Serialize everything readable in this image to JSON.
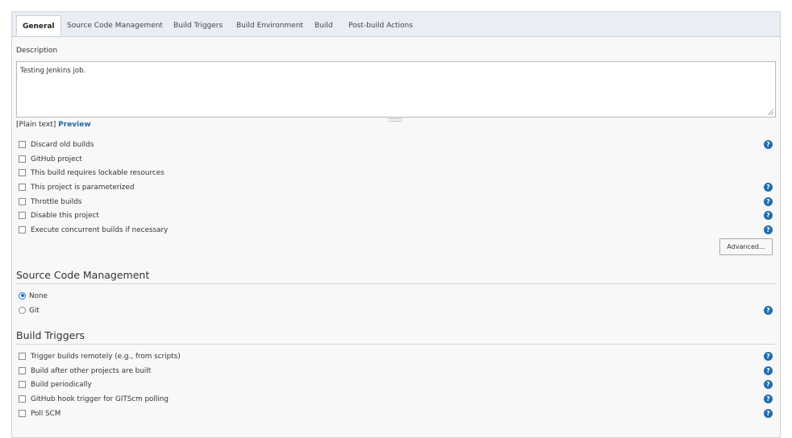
{
  "tabs": [
    {
      "label": "General",
      "active": true
    },
    {
      "label": "Source Code Management",
      "active": false
    },
    {
      "label": "Build Triggers",
      "active": false
    },
    {
      "label": "Build Environment",
      "active": false
    },
    {
      "label": "Build",
      "active": false
    },
    {
      "label": "Post-build Actions",
      "active": false
    }
  ],
  "general": {
    "description_label": "Description",
    "description_value": "Testing Jenkins job.",
    "plain_text_label": "[Plain text]",
    "preview_link": "Preview",
    "options": [
      {
        "label": "Discard old builds",
        "checked": false,
        "help": true
      },
      {
        "label": "GitHub project",
        "checked": false,
        "help": false
      },
      {
        "label": "This build requires lockable resources",
        "checked": false,
        "help": false
      },
      {
        "label": "This project is parameterized",
        "checked": false,
        "help": true
      },
      {
        "label": "Throttle builds",
        "checked": false,
        "help": true
      },
      {
        "label": "Disable this project",
        "checked": false,
        "help": true
      },
      {
        "label": "Execute concurrent builds if necessary",
        "checked": false,
        "help": true
      }
    ],
    "advanced_button": "Advanced..."
  },
  "scm": {
    "title": "Source Code Management",
    "options": [
      {
        "label": "None",
        "selected": true,
        "help": false
      },
      {
        "label": "Git",
        "selected": false,
        "help": true
      }
    ]
  },
  "build_triggers": {
    "title": "Build Triggers",
    "options": [
      {
        "label": "Trigger builds remotely (e.g., from scripts)",
        "checked": false,
        "help": true
      },
      {
        "label": "Build after other projects are built",
        "checked": false,
        "help": true
      },
      {
        "label": "Build periodically",
        "checked": false,
        "help": true
      },
      {
        "label": "GitHub hook trigger for GITScm polling",
        "checked": false,
        "help": true
      },
      {
        "label": "Poll SCM",
        "checked": false,
        "help": true
      }
    ]
  },
  "help_icon_glyph": "?",
  "colors": {
    "help_icon": "#1f6cb0",
    "link": "#2868a8",
    "radio_selected": "#1a73d9"
  }
}
